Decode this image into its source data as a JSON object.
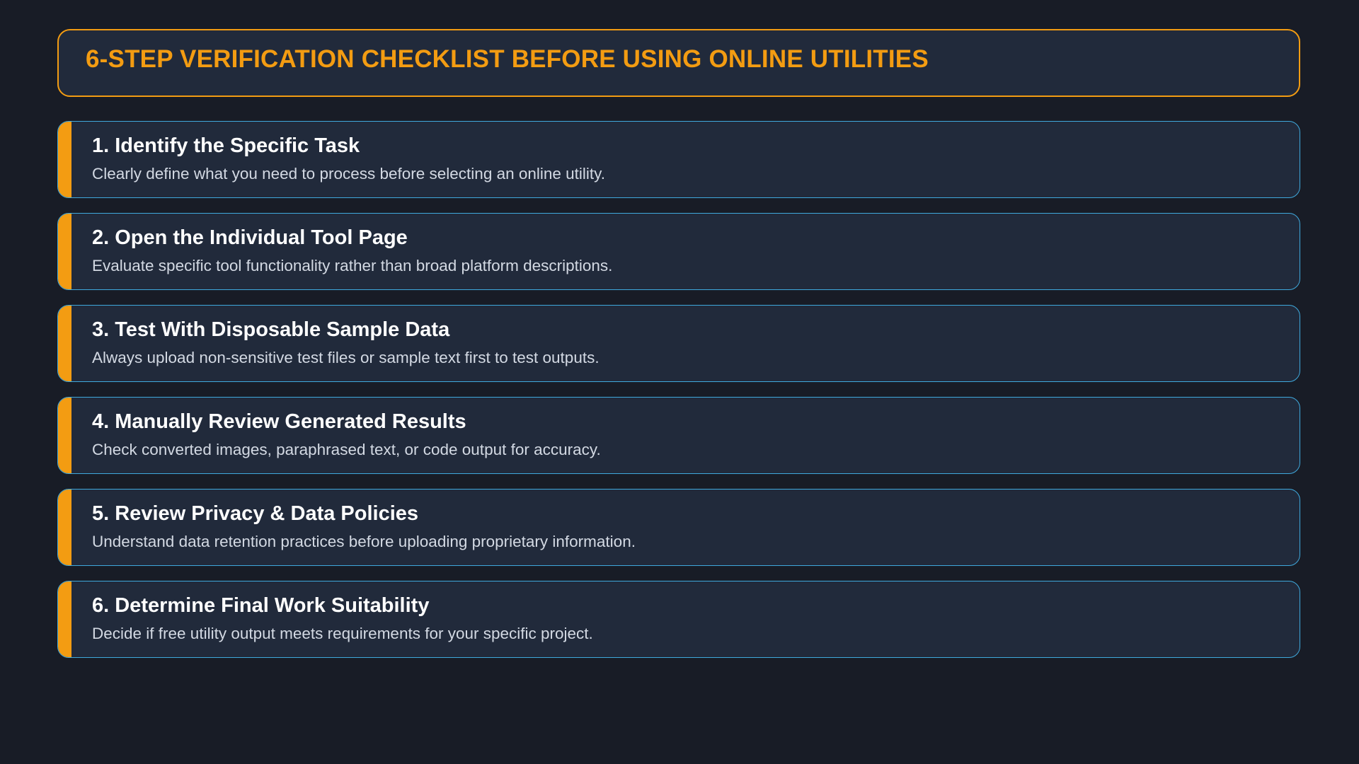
{
  "header": {
    "title": "6-STEP VERIFICATION CHECKLIST BEFORE USING ONLINE UTILITIES"
  },
  "colors": {
    "background": "#181c26",
    "card": "#212a3b",
    "accent": "#f39c12",
    "card_border": "#3fa9dd",
    "step_title": "#ffffff",
    "step_desc": "#d3d9e3"
  },
  "steps": [
    {
      "title": "1. Identify the Specific Task",
      "description": "Clearly define what you need to process before selecting an online utility."
    },
    {
      "title": "2. Open the Individual Tool Page",
      "description": "Evaluate specific tool functionality rather than broad platform descriptions."
    },
    {
      "title": "3. Test With Disposable Sample Data",
      "description": "Always upload non-sensitive test files or sample text first to test outputs."
    },
    {
      "title": "4. Manually Review Generated Results",
      "description": "Check converted images, paraphrased text, or code output for accuracy."
    },
    {
      "title": "5. Review Privacy & Data Policies",
      "description": "Understand data retention practices before uploading proprietary information."
    },
    {
      "title": "6. Determine Final Work Suitability",
      "description": "Decide if free utility output meets requirements for your specific project."
    }
  ]
}
